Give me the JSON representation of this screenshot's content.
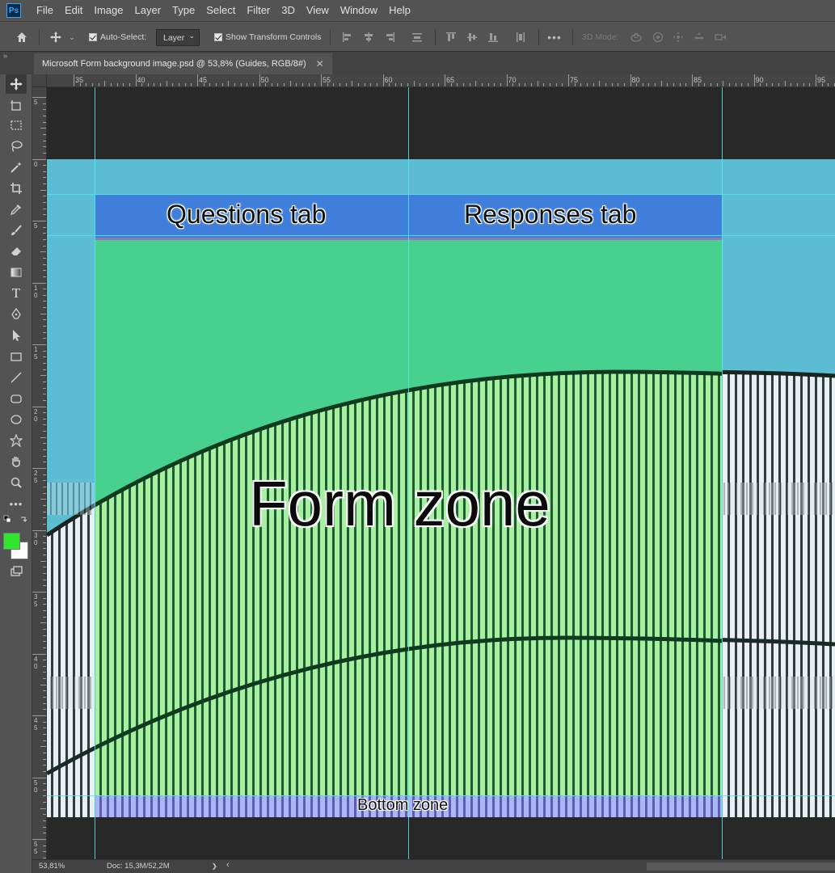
{
  "app": {
    "logo_text": "Ps"
  },
  "menu": [
    "File",
    "Edit",
    "Image",
    "Layer",
    "Type",
    "Select",
    "Filter",
    "3D",
    "View",
    "Window",
    "Help"
  ],
  "options": {
    "auto_select_label": "Auto-Select:",
    "auto_select_checked": true,
    "layer_dropdown": "Layer",
    "show_transform_label": "Show Transform Controls",
    "show_transform_checked": true,
    "more_label": "•••",
    "mode_3d_label": "3D Mode:"
  },
  "panel_toggle": "»",
  "document": {
    "tab_title": "Microsoft Form background image.psd @ 53,8% (Guides, RGB/8#)",
    "close_glyph": "✕"
  },
  "ruler": {
    "horizontal_labels": [
      "35",
      "40",
      "45",
      "50",
      "55",
      "60",
      "65",
      "70",
      "75",
      "80",
      "85",
      "90",
      "95"
    ],
    "vertical_labels": [
      "5",
      "0",
      "5",
      "1\n0",
      "1\n5",
      "2\n0",
      "2\n5",
      "3\n0",
      "3\n5",
      "4\n0",
      "4\n5",
      "5\n0",
      "5\n5"
    ]
  },
  "canvas": {
    "questions_tab_label": "Questions tab",
    "responses_tab_label": "Responses tab",
    "form_zone_label": "Form zone",
    "bottom_zone_label": "Bottom zone"
  },
  "colors": {
    "foreground": "#2ee62e",
    "background": "#ffffff",
    "tabs_zone": "#3f7fdb",
    "form_zone": "#47d08e",
    "bottom_zone": "#9ea7f2",
    "sky": "#5cbdd3",
    "guide": "#4fe6f0"
  },
  "status": {
    "zoom": "53,81%",
    "doc_size": "Doc: 15,3M/52,2M",
    "arrow": "❯",
    "left_arrow": "‹"
  }
}
